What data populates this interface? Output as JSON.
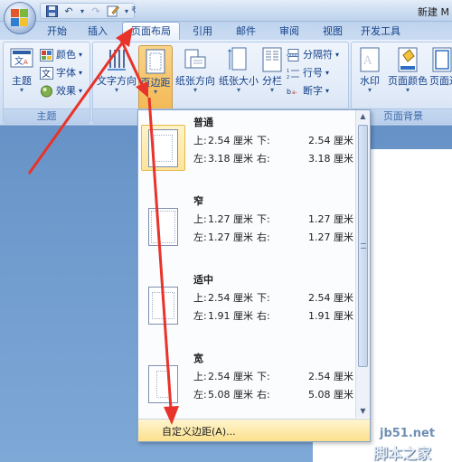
{
  "window": {
    "title": "新建 M"
  },
  "quick_access": {
    "icons": [
      "save-icon",
      "undo-icon",
      "redo-icon",
      "edit-icon",
      "customize-icon"
    ],
    "undo_glyph": "↶",
    "redo_glyph": "↷",
    "dropdown_glyph": "▾",
    "more_glyph": "₹"
  },
  "tabs": [
    {
      "label": "开始",
      "active": false
    },
    {
      "label": "插入",
      "active": false
    },
    {
      "label": "页面布局",
      "active": true
    },
    {
      "label": "引用",
      "active": false
    },
    {
      "label": "邮件",
      "active": false
    },
    {
      "label": "审阅",
      "active": false
    },
    {
      "label": "视图",
      "active": false
    },
    {
      "label": "开发工具",
      "active": false
    }
  ],
  "ribbon": {
    "theme_group": {
      "label": "主题",
      "theme_button": "主题",
      "colors": "颜色",
      "fonts": "字体",
      "effects": "效果"
    },
    "page_setup_group": {
      "text_direction": "文字方向",
      "margins": "页边距",
      "orientation": "纸张方向",
      "size": "纸张大小",
      "columns": "分栏",
      "breaks": "分隔符",
      "line_numbers": "行号",
      "hyphenation": "断字"
    },
    "page_background_group": {
      "label": "页面背景",
      "watermark": "水印",
      "page_color": "页面颜色",
      "page_borders": "页面边框"
    }
  },
  "margins_menu": {
    "top_label": "上:",
    "bottom_label": "下:",
    "left_label": "左:",
    "right_label": "右:",
    "unit": "厘米",
    "presets": [
      {
        "name": "普通",
        "top": "2.54",
        "bottom": "2.54",
        "left": "3.18",
        "right": "3.18",
        "selected": true
      },
      {
        "name": "窄",
        "top": "1.27",
        "bottom": "1.27",
        "left": "1.27",
        "right": "1.27",
        "selected": false
      },
      {
        "name": "适中",
        "top": "2.54",
        "bottom": "2.54",
        "left": "1.91",
        "right": "1.91",
        "selected": false
      },
      {
        "name": "宽",
        "top": "2.54",
        "bottom": "2.54",
        "left": "5.08",
        "right": "5.08",
        "selected": false
      }
    ],
    "custom": "自定义边距(A)..."
  },
  "watermark": {
    "url": "jb51.net",
    "cn": "脚本之家"
  },
  "colors": {
    "accent": "#15428b",
    "annotation_red": "#e8332a",
    "hover_gold": "#fbe08c"
  }
}
